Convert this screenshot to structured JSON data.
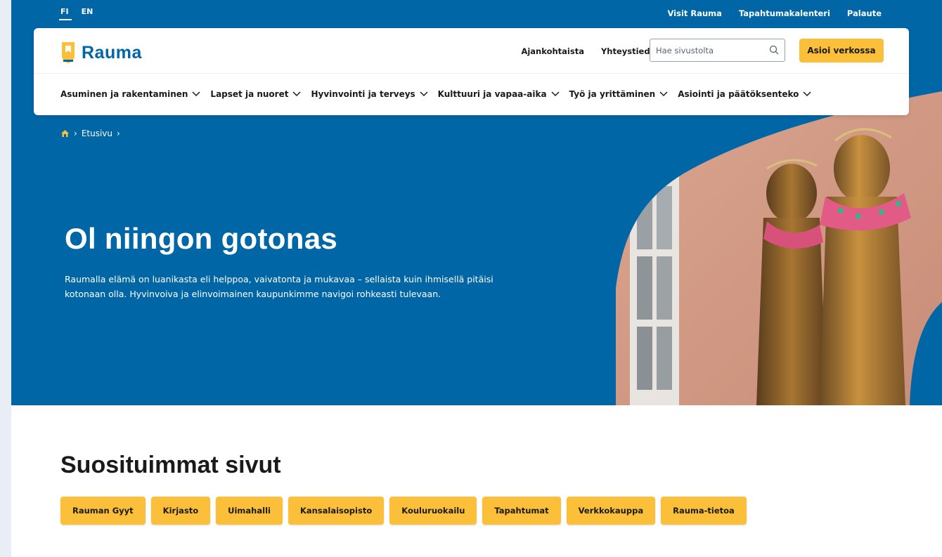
{
  "lang_switch": [
    {
      "label": "FI",
      "active": true
    },
    {
      "label": "EN",
      "active": false
    }
  ],
  "utility_links": [
    "Visit Rauma",
    "Tapahtumakalenteri",
    "Palaute"
  ],
  "brand": {
    "name": "Rauma",
    "logo_icon": "rauma-logo-icon",
    "color": "#0066a5"
  },
  "header": {
    "links": [
      "Ajankohtaista",
      "Yhteystiedot"
    ],
    "search": {
      "placeholder": "Hae sivustolta",
      "icon": "search-icon"
    },
    "cta_label": "Asioi verkossa"
  },
  "main_nav": [
    {
      "label": "Asuminen ja rakentaminen"
    },
    {
      "label": "Lapset ja nuoret"
    },
    {
      "label": "Hyvinvointi ja terveys"
    },
    {
      "label": "Kulttuuri ja vapaa-aika"
    },
    {
      "label": "Työ ja yrittäminen"
    },
    {
      "label": "Asiointi ja päätöksenteko"
    }
  ],
  "breadcrumb": {
    "home_icon": "home-icon",
    "separator": "›",
    "items": [
      "Etusivu"
    ]
  },
  "hero": {
    "title": "Ol niingon gotonas",
    "text": "Raumalla elämä on luanikasta eli helppoa, vaivatonta ja mukavaa – sellaista kuin ihmisellä pitäisi kotonaan olla. Hyvinvoiva ja elinvoimainen kaupunkimme navigoi rohkeasti tulevaan."
  },
  "popular": {
    "title": "Suosituimmat sivut",
    "items": [
      "Rauman Gyyt",
      "Kirjasto",
      "Uimahalli",
      "Kansalaisopisto",
      "Kouluruokailu",
      "Tapahtumat",
      "Verkkokauppa",
      "Rauma-tietoa"
    ]
  },
  "colors": {
    "primary": "#0066a5",
    "accent": "#fbbf3a",
    "text": "#1a1a1a",
    "page_bg": "#e9edf6"
  }
}
